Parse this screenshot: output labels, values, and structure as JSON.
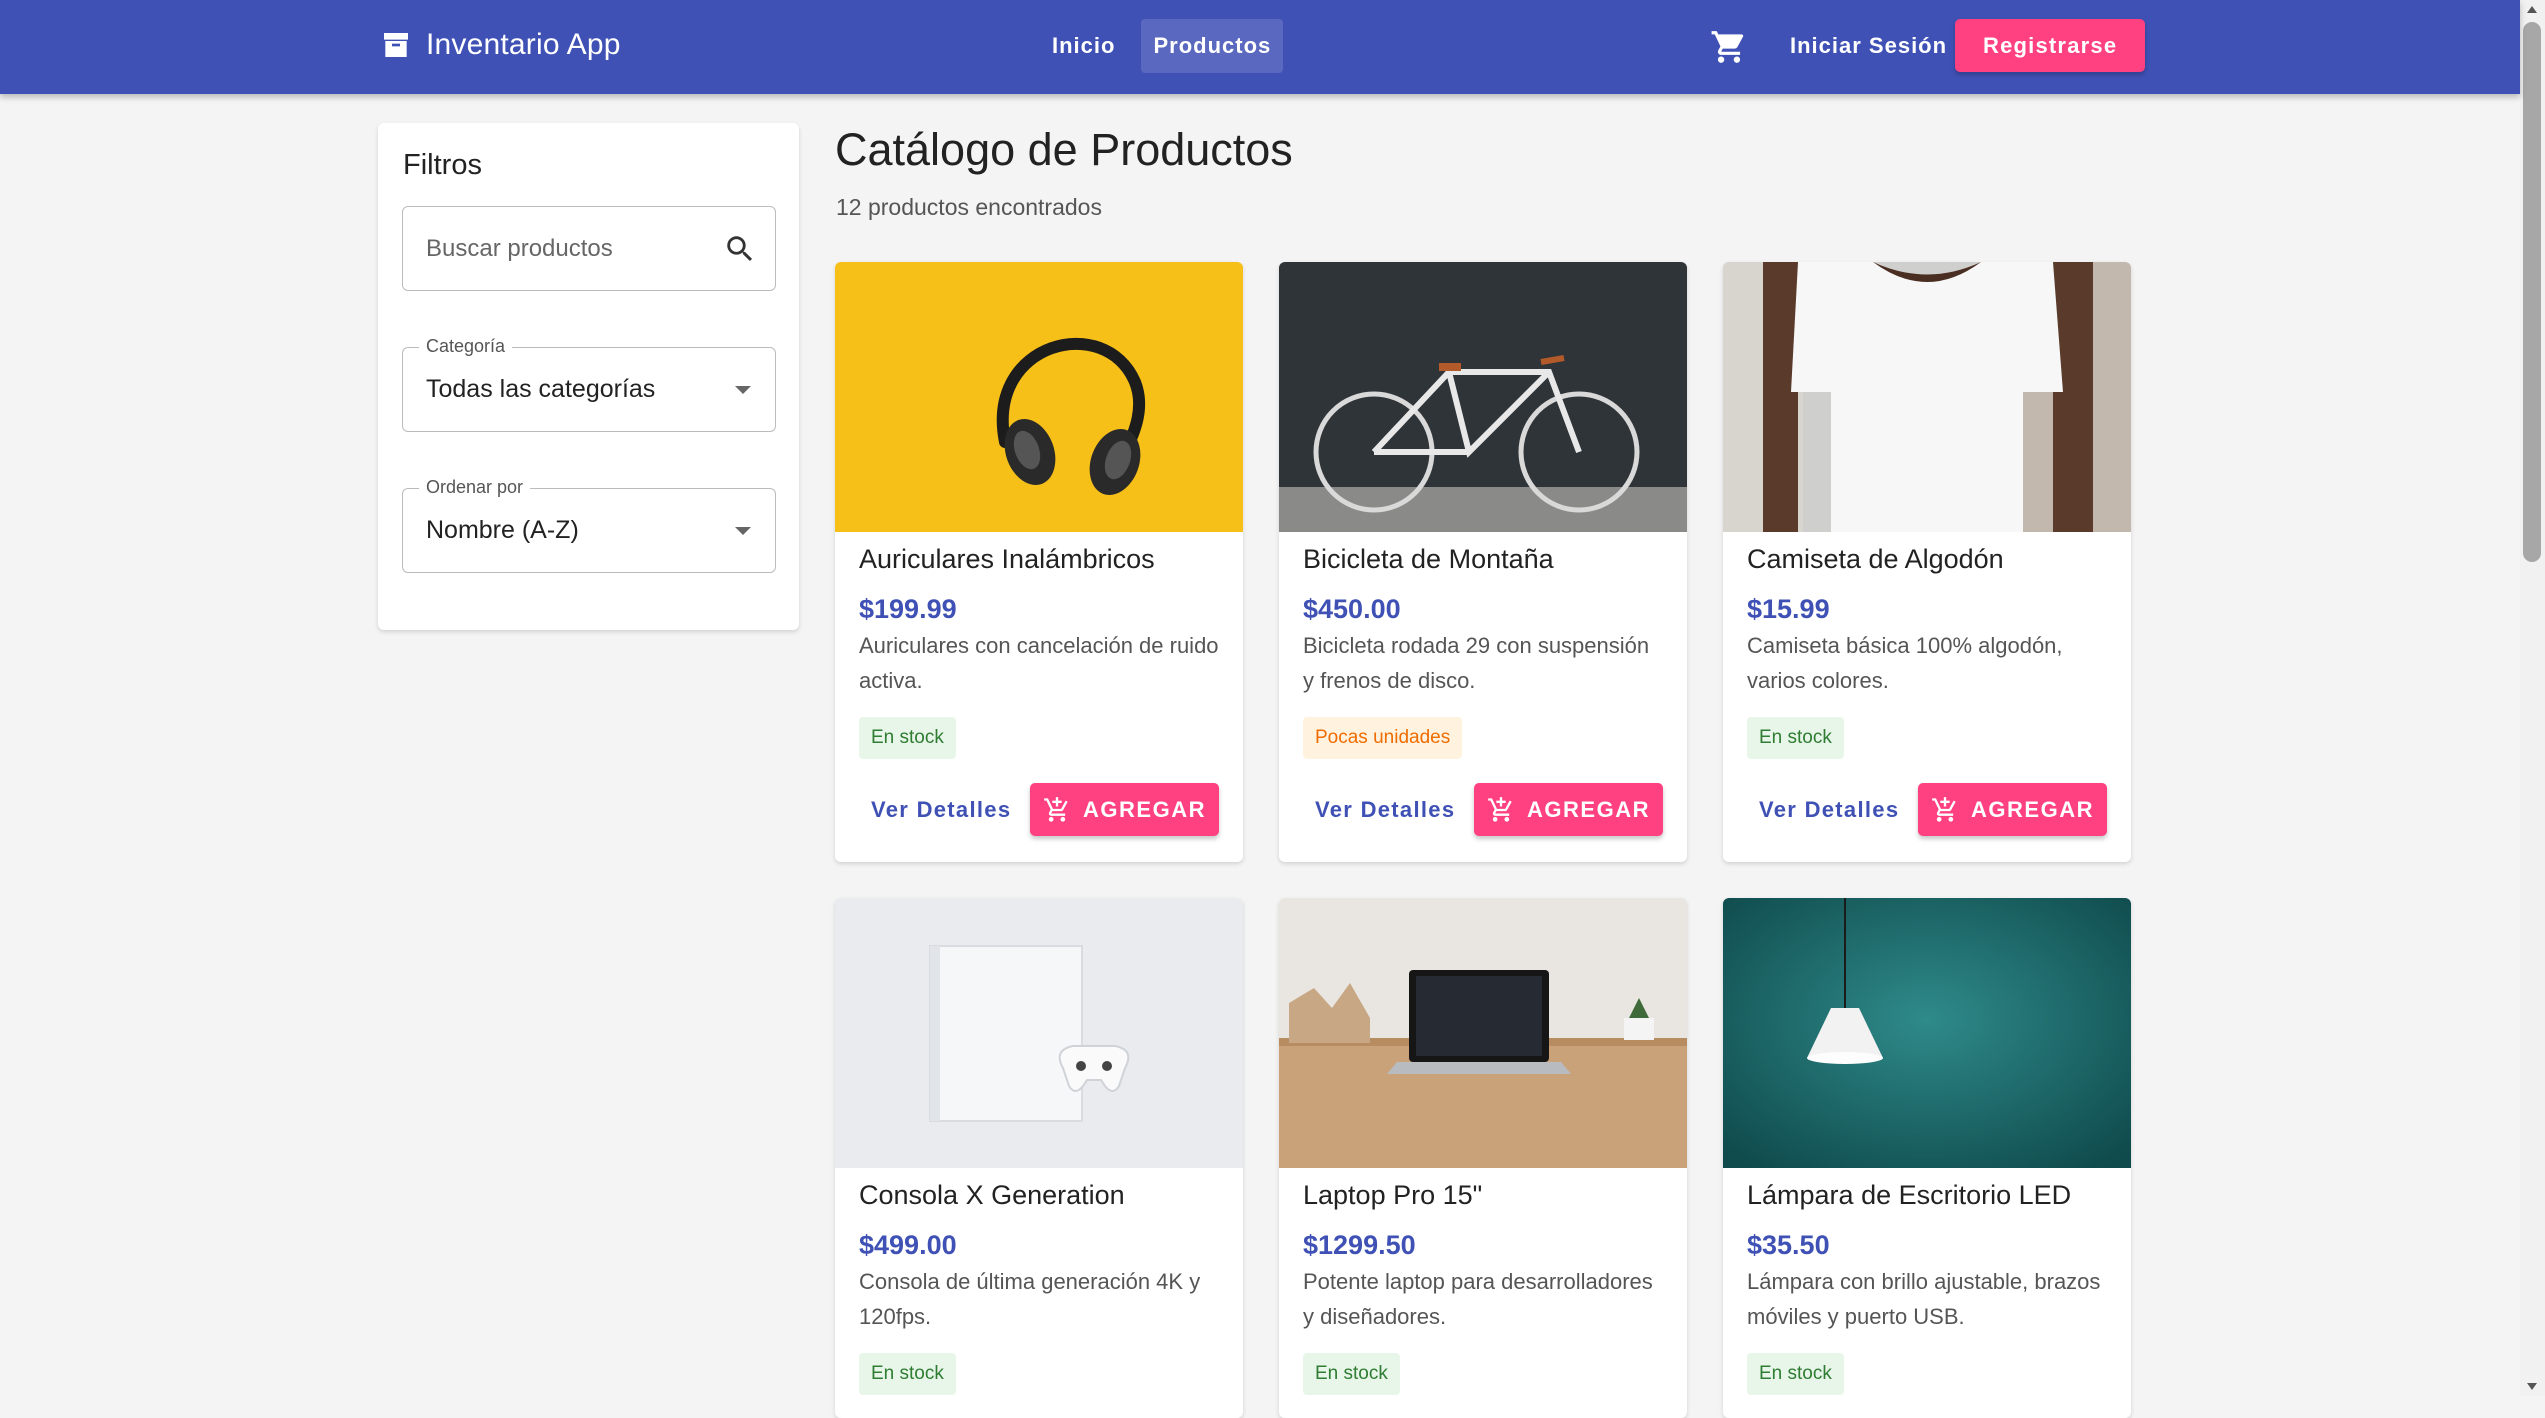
{
  "app": {
    "title": "Inventario App",
    "nav": [
      "Inicio",
      "Productos"
    ],
    "active_nav": "Productos",
    "login_label": "Iniciar Sesión",
    "register_label": "Registrarse",
    "icons": {
      "logo": "archive-icon",
      "cart": "shopping-cart-icon"
    }
  },
  "colors": {
    "primary": "#3f51b5",
    "accent": "#ff4081",
    "in_stock_bg": "#e8f5e9",
    "in_stock_text": "#2e7d32",
    "low_stock_bg": "#fff3e0",
    "low_stock_text": "#ef6c00"
  },
  "filters": {
    "title": "Filtros",
    "search_placeholder": "Buscar productos",
    "category": {
      "label": "Categoría",
      "value": "Todas las categorías"
    },
    "sort": {
      "label": "Ordenar por",
      "value": "Nombre (A-Z)"
    }
  },
  "catalog": {
    "title": "Catálogo de Productos",
    "count_text": "12 productos encontrados",
    "details_label": "Ver Detalles",
    "add_label": "AGREGAR",
    "products": [
      {
        "name": "Auriculares Inalámbricos",
        "price": "$199.99",
        "description": "Auriculares con cancelación de ruido activa.",
        "stock": "En stock",
        "stock_type": "in",
        "image": "headphones"
      },
      {
        "name": "Bicicleta de Montaña",
        "price": "$450.00",
        "description": "Bicicleta rodada 29 con suspensión y frenos de disco.",
        "stock": "Pocas unidades",
        "stock_type": "low",
        "image": "bicycle"
      },
      {
        "name": "Camiseta de Algodón",
        "price": "$15.99",
        "description": "Camiseta básica 100% algodón, varios colores.",
        "stock": "En stock",
        "stock_type": "in",
        "image": "tshirt"
      },
      {
        "name": "Consola X Generation",
        "price": "$499.00",
        "description": "Consola de última generación 4K y 120fps.",
        "stock": "En stock",
        "stock_type": "in",
        "image": "console"
      },
      {
        "name": "Laptop Pro 15\"",
        "price": "$1299.50",
        "description": "Potente laptop para desarrolladores y diseñadores.",
        "stock": "En stock",
        "stock_type": "in",
        "image": "laptop"
      },
      {
        "name": "Lámpara de Escritorio LED",
        "price": "$35.50",
        "description": "Lámpara con brillo ajustable, brazos móviles y puerto USB.",
        "stock": "En stock",
        "stock_type": "in",
        "image": "lamp"
      }
    ]
  }
}
